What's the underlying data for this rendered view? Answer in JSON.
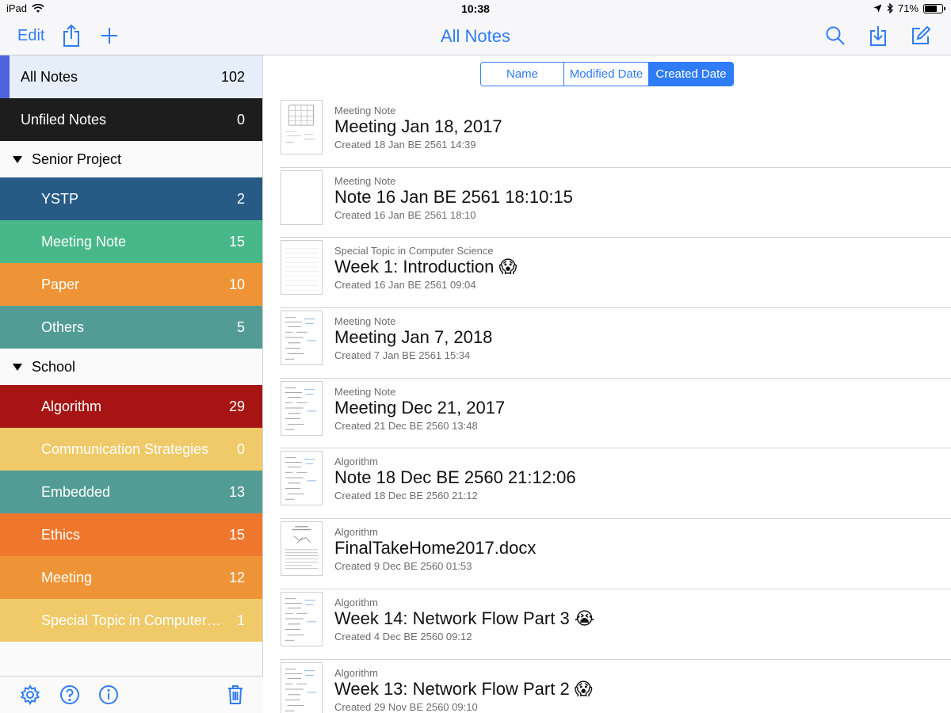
{
  "status": {
    "device": "iPad",
    "time": "10:38",
    "battery": "71%",
    "battery_level": 0.71
  },
  "nav": {
    "edit_label": "Edit",
    "title": "All Notes",
    "icons": [
      "share-icon",
      "plus-icon",
      "search-icon",
      "download-icon",
      "compose-icon"
    ]
  },
  "sidebar": {
    "all": {
      "label": "All Notes",
      "count": "102"
    },
    "unfiled": {
      "label": "Unfiled Notes",
      "count": "0"
    },
    "groups": [
      {
        "label": "Senior Project",
        "items": [
          {
            "label": "YSTP",
            "count": "2",
            "color": "#275b86"
          },
          {
            "label": "Meeting Note",
            "count": "15",
            "color": "#48b889"
          },
          {
            "label": "Paper",
            "count": "10",
            "color": "#ee9436"
          },
          {
            "label": "Others",
            "count": "5",
            "color": "#539c96"
          }
        ]
      },
      {
        "label": "School",
        "items": [
          {
            "label": "Algorithm",
            "count": "29",
            "color": "#a61513"
          },
          {
            "label": "Communication Strategies",
            "count": "0",
            "color": "#f0ca69"
          },
          {
            "label": "Embedded",
            "count": "13",
            "color": "#539c96"
          },
          {
            "label": "Ethics",
            "count": "15",
            "color": "#ef762d"
          },
          {
            "label": "Meeting",
            "count": "12",
            "color": "#ee9436"
          },
          {
            "label": "Special Topic in Computer…",
            "count": "1",
            "color": "#f0ca69"
          }
        ]
      }
    ],
    "footer_icons": [
      "gear-icon",
      "help-icon",
      "info-icon",
      "trash-icon"
    ]
  },
  "sort": {
    "options": [
      "Name",
      "Modified Date",
      "Created Date"
    ],
    "selected": "Created Date"
  },
  "notes": [
    {
      "category": "Meeting Note",
      "title": "Meeting Jan 18, 2017",
      "created": "Created 18 Jan BE 2561 14:39",
      "thumb": "grid"
    },
    {
      "category": "Meeting Note",
      "title": "Note 16 Jan BE 2561 18:10:15",
      "created": "Created 16 Jan BE 2561 18:10",
      "thumb": "blank"
    },
    {
      "category": "Special Topic in Computer Science",
      "title": "Week 1: Introduction 😱",
      "created": "Created 16 Jan BE 2561 09:04",
      "thumb": "lined"
    },
    {
      "category": "Meeting Note",
      "title": "Meeting Jan 7, 2018",
      "created": "Created 7 Jan BE 2561 15:34",
      "thumb": "writing"
    },
    {
      "category": "Meeting Note",
      "title": "Meeting Dec 21, 2017",
      "created": "Created 21 Dec BE 2560 13:48",
      "thumb": "writing"
    },
    {
      "category": "Algorithm",
      "title": "Note 18 Dec BE 2560 21:12:06",
      "created": "Created 18 Dec BE 2560 21:12",
      "thumb": "writing"
    },
    {
      "category": "Algorithm",
      "title": "FinalTakeHome2017.docx",
      "created": "Created 9 Dec BE 2560 01:53",
      "thumb": "document"
    },
    {
      "category": "Algorithm",
      "title": "Week 14: Network Flow Part 3 😭",
      "created": "Created 4 Dec BE 2560 09:12",
      "thumb": "writing"
    },
    {
      "category": "Algorithm",
      "title": "Week 13: Network Flow Part 2 😱",
      "created": "Created 29 Nov BE 2560 09:10",
      "thumb": "writing"
    }
  ]
}
